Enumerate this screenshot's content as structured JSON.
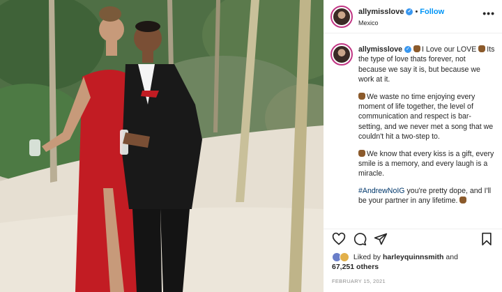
{
  "post": {
    "username": "allymisslove",
    "location": "Mexico",
    "follow_label": "Follow",
    "more_label": "•••",
    "verified_mark": "✓",
    "separator": "•"
  },
  "caption": {
    "username": "allymisslove",
    "intro": "I Love our LOVE",
    "line1": "Its the type of love thats forever, not because we say it is, but because we work at it.",
    "line2": "We waste no time enjoying every moment of life together, the level of communication and respect is bar-setting, and we never met a song that we couldn't hit a two-step to.",
    "line3": "We know that every kiss is a gift, every smile is a memory, and every laugh is a miracle.",
    "hashtag": "#AndrewNoIG",
    "closing": "you're pretty dope, and I'll be your partner in any lifetime."
  },
  "engagement": {
    "liked_by_prefix": "Liked by",
    "liked_by_user": "harleyquinnsmith",
    "and_label": "and",
    "others_count": "67,251 others"
  },
  "date": "FEBRUARY 15, 2021",
  "icons": {
    "like": "heart-icon",
    "comment": "comment-icon",
    "share": "paper-plane-icon",
    "save": "bookmark-icon"
  },
  "colors": {
    "link_blue": "#0095f6",
    "verified_blue": "#3897f0",
    "hashtag": "#00376b",
    "dress_red": "#c21c23"
  }
}
